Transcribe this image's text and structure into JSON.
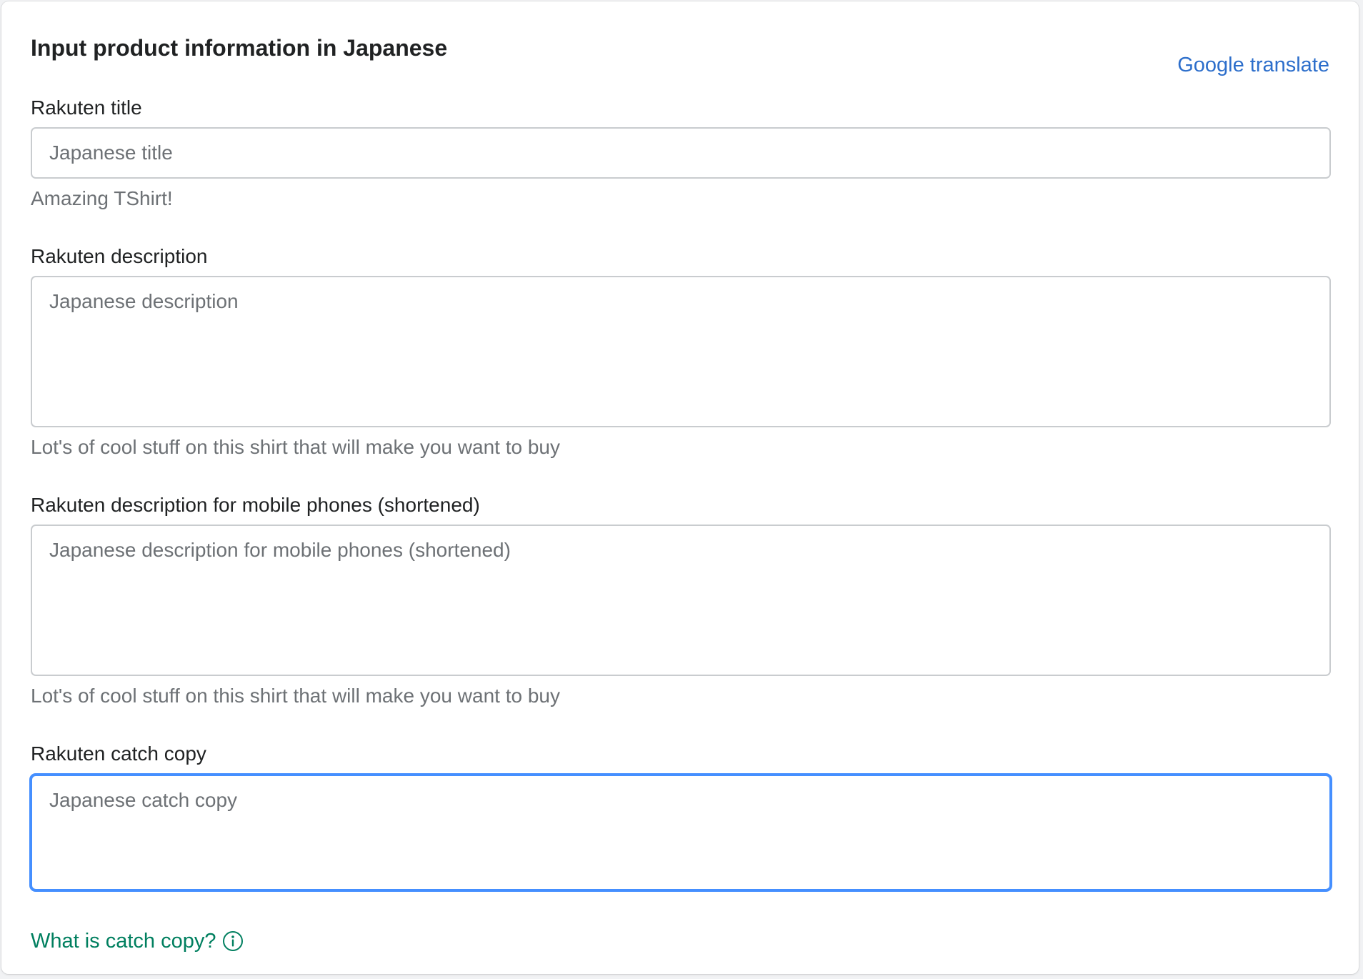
{
  "card": {
    "title": "Input product information in Japanese",
    "translate_link": "Google translate"
  },
  "fields": {
    "title": {
      "label": "Rakuten title",
      "placeholder": "Japanese title",
      "value": "",
      "help": "Amazing TShirt!"
    },
    "description": {
      "label": "Rakuten description",
      "placeholder": "Japanese description",
      "value": "",
      "help": "Lot's of cool stuff on this shirt that will make you want to buy"
    },
    "mobile_description": {
      "label": "Rakuten description for mobile phones (shortened)",
      "placeholder": "Japanese description for mobile phones (shortened)",
      "value": "",
      "help": "Lot's of cool stuff on this shirt that will make you want to buy"
    },
    "catch_copy": {
      "label": "Rakuten catch copy",
      "placeholder": "Japanese catch copy",
      "value": "",
      "focused": true
    }
  },
  "footer": {
    "catch_copy_link": "What is catch copy?",
    "info_icon": "info-circle-icon"
  },
  "colors": {
    "link_blue": "#2c6ecb",
    "link_green": "#007f5f",
    "focus_ring": "#458fff",
    "border": "#c9cccf",
    "subdued_text": "#6d7175"
  }
}
